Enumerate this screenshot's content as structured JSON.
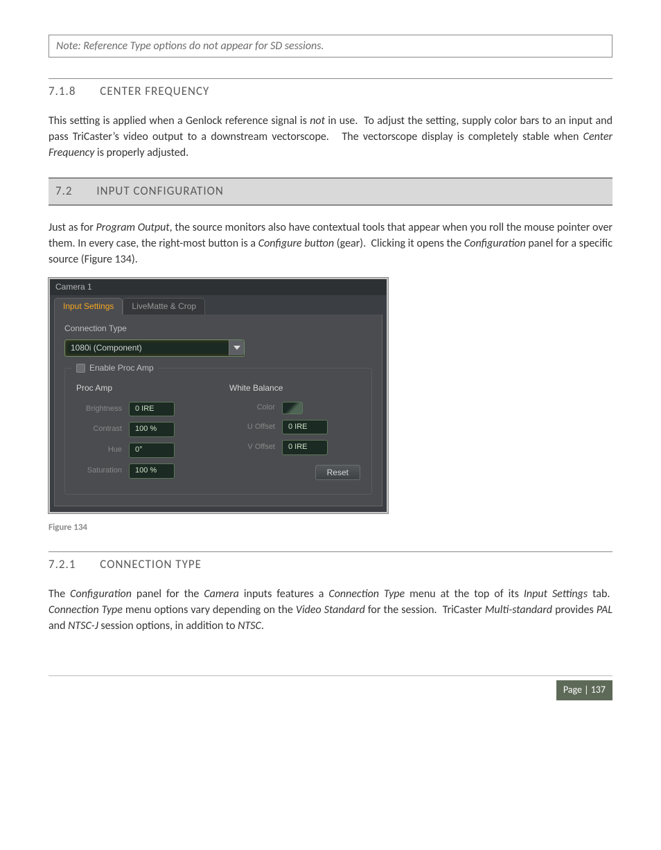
{
  "note": "Note: Reference Type options do not appear for SD sessions.",
  "sec718": {
    "num": "7.1.8",
    "title": "CENTER FREQUENCY",
    "para": "This setting is applied when a Genlock reference signal is not in use.  To adjust the setting, supply color bars to an input and pass TriCaster’s video output to a downstream vectorscope.   The vectorscope display is completely stable when Center Frequency is properly adjusted."
  },
  "sec72": {
    "num": "7.2",
    "title": "INPUT CONFIGURATION",
    "para": "Just as for Program Output, the source monitors also have contextual tools that appear when you roll the mouse pointer over them. In every case, the right-most button is a Configure button (gear).  Clicking it opens the Configuration panel for a specific source (Figure 134)."
  },
  "shot": {
    "window_title": "Camera 1",
    "tabs": {
      "active": "Input Settings",
      "inactive": "LiveMatte & Crop"
    },
    "connection_type_label": "Connection Type",
    "dropdown_value": "1080i (Component)",
    "fieldset_legend": "Enable Proc Amp",
    "proc_amp_heading": "Proc Amp",
    "white_balance_heading": "White Balance",
    "rows": {
      "brightness": {
        "label": "Brightness",
        "value": "0 IRE"
      },
      "contrast": {
        "label": "Contrast",
        "value": "100 %"
      },
      "hue": {
        "label": "Hue",
        "value": "0°"
      },
      "saturation": {
        "label": "Saturation",
        "value": "100 %"
      },
      "color": {
        "label": "Color"
      },
      "u_offset": {
        "label": "U Offset",
        "value": "0 IRE"
      },
      "v_offset": {
        "label": "V Offset",
        "value": "0 IRE"
      }
    },
    "reset_label": "Reset"
  },
  "figure_caption": "Figure 134",
  "sec721": {
    "num": "7.2.1",
    "title": "CONNECTION TYPE",
    "para": "The Configuration panel for the Camera inputs features a Connection Type menu at the top of its Input Settings tab.  Connection Type menu options vary depending on the Video Standard for the session.  TriCaster Multi-standard provides PAL and NTSC-J session options, in addition to NTSC."
  },
  "footer": {
    "page_label": "Page | 137"
  }
}
